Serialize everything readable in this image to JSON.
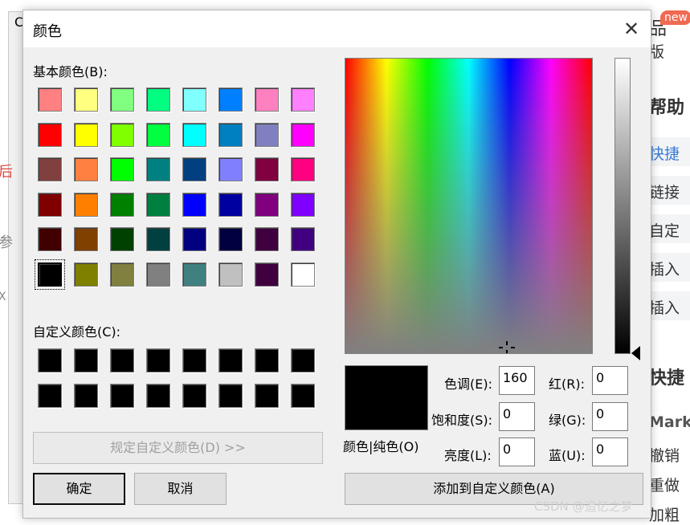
{
  "background": {
    "left_fragments": [
      "C",
      "后",
      "参",
      "X"
    ],
    "right_items": [
      "品",
      "版",
      "帮助",
      "快捷",
      "链接",
      "自定",
      "插入",
      "插入",
      "快捷",
      "Mark",
      "撤销",
      "重做",
      "加粗"
    ],
    "new_badge": "new",
    "watermark": "CSDN @追忆之梦"
  },
  "dialog": {
    "title": "颜色",
    "close_glyph": "✕",
    "basic_label": "基本颜色(B):",
    "custom_label": "自定义颜色(C):",
    "define_custom_button": "规定自定义颜色(D) >>",
    "ok_button": "确定",
    "cancel_button": "取消",
    "add_custom_button": "添加到自定义颜色(A)",
    "preview_label": "颜色|纯色(O)",
    "fields": {
      "hue": {
        "label": "色调(E):",
        "value": "160"
      },
      "saturation": {
        "label": "饱和度(S):",
        "value": "0"
      },
      "luminance": {
        "label": "亮度(L):",
        "value": "0"
      },
      "red": {
        "label": "红(R):",
        "value": "0"
      },
      "green": {
        "label": "绿(G):",
        "value": "0"
      },
      "blue": {
        "label": "蓝(U):",
        "value": "0"
      }
    },
    "current_color": "#000000",
    "basic_colors": [
      "#ff8080",
      "#ffff80",
      "#80ff80",
      "#00ff80",
      "#80ffff",
      "#0080ff",
      "#ff80c0",
      "#ff80ff",
      "#ff0000",
      "#ffff00",
      "#80ff00",
      "#00ff40",
      "#00ffff",
      "#0080c0",
      "#8080c0",
      "#ff00ff",
      "#804040",
      "#ff8040",
      "#00ff00",
      "#008080",
      "#004080",
      "#8080ff",
      "#800040",
      "#ff0080",
      "#800000",
      "#ff8000",
      "#008000",
      "#008040",
      "#0000ff",
      "#0000a0",
      "#800080",
      "#8000ff",
      "#400000",
      "#804000",
      "#004000",
      "#004040",
      "#000080",
      "#000040",
      "#400040",
      "#400080",
      "#000000",
      "#808000",
      "#808040",
      "#808080",
      "#408080",
      "#c0c0c0",
      "#400040",
      "#ffffff"
    ],
    "selected_basic_index": 40,
    "custom_colors": [
      "#000000",
      "#000000",
      "#000000",
      "#000000",
      "#000000",
      "#000000",
      "#000000",
      "#000000",
      "#000000",
      "#000000",
      "#000000",
      "#000000",
      "#000000",
      "#000000",
      "#000000",
      "#000000"
    ]
  }
}
